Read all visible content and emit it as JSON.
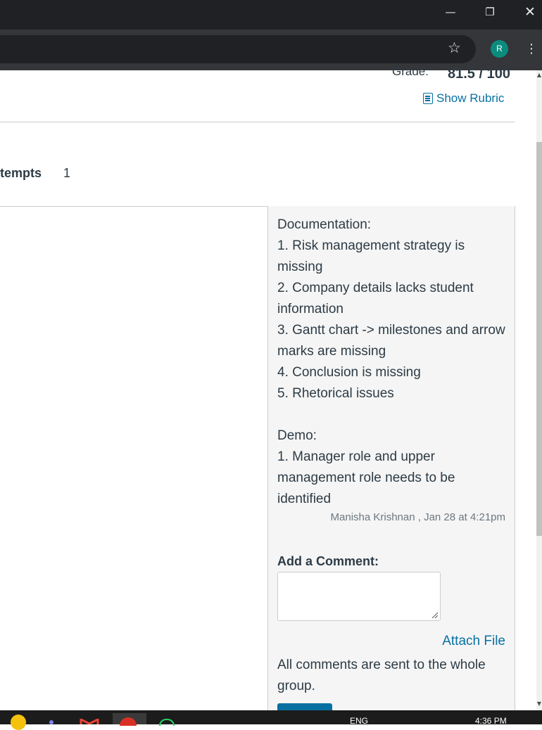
{
  "browser": {
    "window_controls": {
      "minimize": "—",
      "maximize": "❐",
      "close": "✕"
    },
    "bookmark_icon": "star-icon",
    "profile_initial": "R",
    "profile_color": "#0b8c7d",
    "menu_icon": "⋮"
  },
  "grade": {
    "label": "Grade:",
    "value": "81.5 / 100",
    "rubric_link": "Show Rubric"
  },
  "attempts": {
    "label": "tempts",
    "value": "1"
  },
  "comment": {
    "lines": [
      "Documentation:",
      "1. Risk management strategy is missing",
      "2. Company details lacks student information",
      "3. Gantt chart -> milestones and arrow marks are missing",
      "4. Conclusion is missing",
      "5. Rhetorical issues",
      "",
      "Demo:",
      "1. Manager role and upper management role needs to be identified"
    ],
    "author": "Manisha Krishnan , Jan 28 at 4:21pm"
  },
  "add_comment": {
    "label": "Add a Comment:",
    "value": "",
    "attach_label": "Attach File",
    "notice": "All comments are sent to the whole group."
  },
  "taskbar": {
    "language": "ENG",
    "time": "4:36 PM"
  },
  "colors": {
    "link": "#0770a3",
    "text": "#2d3b45",
    "panel": "#f5f5f5"
  }
}
